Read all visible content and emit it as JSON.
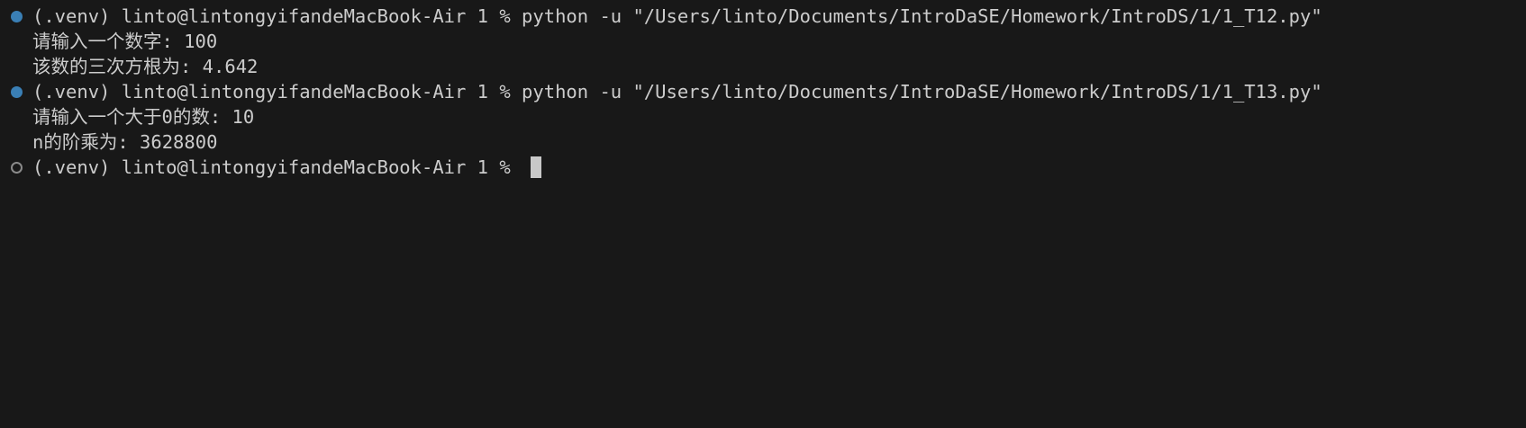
{
  "terminal": {
    "lines": [
      {
        "marker": "success",
        "text": "(.venv) linto@lintongyifandeMacBook-Air 1 % python -u \"/Users/linto/Documents/IntroDaSE/Homework/IntroDS/1/1_T12.py\""
      },
      {
        "marker": "none",
        "text": "请输入一个数字: 100"
      },
      {
        "marker": "none",
        "text": "该数的三次方根为: 4.642"
      },
      {
        "marker": "success",
        "text": "(.venv) linto@lintongyifandeMacBook-Air 1 % python -u \"/Users/linto/Documents/IntroDaSE/Homework/IntroDS/1/1_T13.py\""
      },
      {
        "marker": "none",
        "text": "请输入一个大于0的数: 10"
      },
      {
        "marker": "none",
        "text": "n的阶乘为: 3628800"
      },
      {
        "marker": "pending",
        "text": "(.venv) linto@lintongyifandeMacBook-Air 1 % "
      }
    ]
  },
  "colors": {
    "background": "#181818",
    "foreground": "#cccccc",
    "success_dot": "#3a7fb5",
    "pending_dot": "#8a8a8a",
    "cursor": "#c8c8c8"
  },
  "icons": {
    "success": "command-success-dot-icon",
    "pending": "command-pending-dot-icon"
  }
}
